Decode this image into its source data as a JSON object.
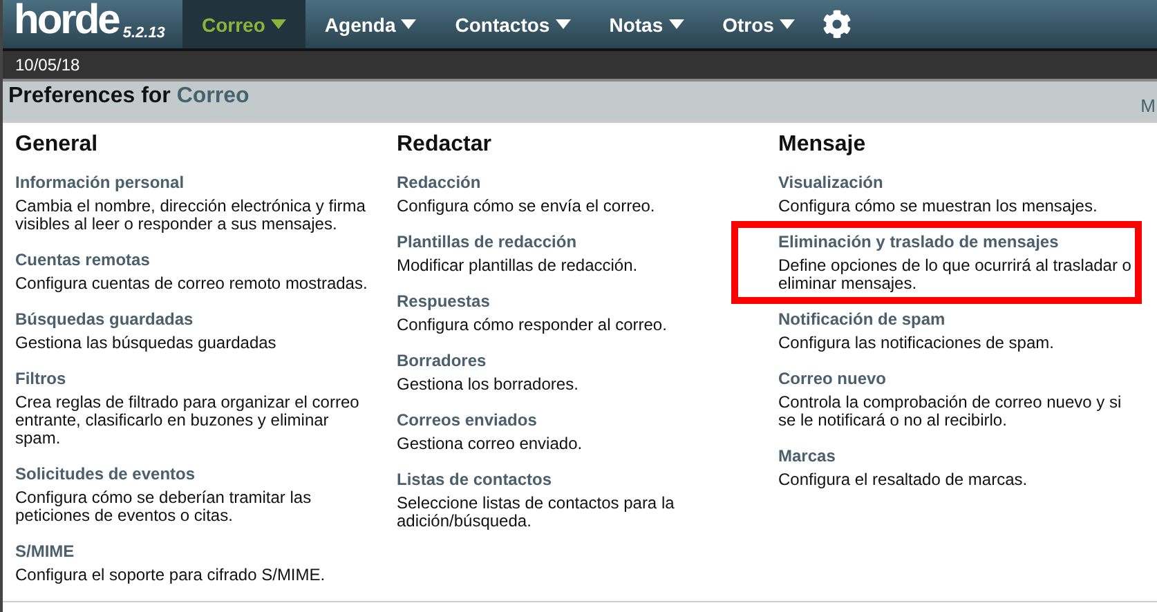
{
  "logo": {
    "name": "horde",
    "version": "5.2.13"
  },
  "menu": [
    {
      "label": "Correo",
      "selected": true
    },
    {
      "label": "Agenda",
      "selected": false
    },
    {
      "label": "Contactos",
      "selected": false
    },
    {
      "label": "Notas",
      "selected": false
    },
    {
      "label": "Otros",
      "selected": false
    }
  ],
  "date": "10/05/18",
  "header": {
    "prefix": "Preferences for",
    "app": "Correo",
    "cut_text": "M"
  },
  "columns": [
    {
      "title": "General",
      "items": [
        {
          "title": "Información personal",
          "description": "Cambia el nombre, dirección electrónica y firma visibles al leer o responder a sus mensajes.",
          "highlighted": false
        },
        {
          "title": "Cuentas remotas",
          "description": "Configura cuentas de correo remoto mostradas.",
          "highlighted": false
        },
        {
          "title": "Búsquedas guardadas",
          "description": "Gestiona las búsquedas guardadas",
          "highlighted": false
        },
        {
          "title": "Filtros",
          "description": "Crea reglas de filtrado para organizar el correo entrante, clasificarlo en buzones y eliminar spam.",
          "highlighted": false
        },
        {
          "title": "Solicitudes de eventos",
          "description": "Configura cómo se deberían tramitar las peticiones de eventos o citas.",
          "highlighted": false
        },
        {
          "title": "S/MIME",
          "description": "Configura el soporte para cifrado S/MIME.",
          "highlighted": false
        }
      ]
    },
    {
      "title": "Redactar",
      "items": [
        {
          "title": "Redacción",
          "description": "Configura cómo se envía el correo.",
          "highlighted": false
        },
        {
          "title": "Plantillas de redacción",
          "description": "Modificar plantillas de redacción.",
          "highlighted": false
        },
        {
          "title": "Respuestas",
          "description": "Configura cómo responder al correo.",
          "highlighted": false
        },
        {
          "title": "Borradores",
          "description": "Gestiona los borradores.",
          "highlighted": false
        },
        {
          "title": "Correos enviados",
          "description": "Gestiona correo enviado.",
          "highlighted": false
        },
        {
          "title": "Listas de contactos",
          "description": "Seleccione listas de contactos para la adición/búsqueda.",
          "highlighted": false
        }
      ]
    },
    {
      "title": "Mensaje",
      "items": [
        {
          "title": "Visualización",
          "description": "Configura cómo se muestran los mensajes.",
          "highlighted": false
        },
        {
          "title": "Eliminación y traslado de mensajes",
          "description": "Define opciones de lo que ocurrirá al trasladar o eliminar mensajes.",
          "highlighted": true
        },
        {
          "title": "Notificación de spam",
          "description": "Configura las notificaciones de spam.",
          "highlighted": false
        },
        {
          "title": "Correo nuevo",
          "description": "Controla la comprobación de correo nuevo y si se le notificará o no al recibirlo.",
          "highlighted": false
        },
        {
          "title": "Marcas",
          "description": "Configura el resaltado de marcas.",
          "highlighted": false
        }
      ]
    }
  ]
}
